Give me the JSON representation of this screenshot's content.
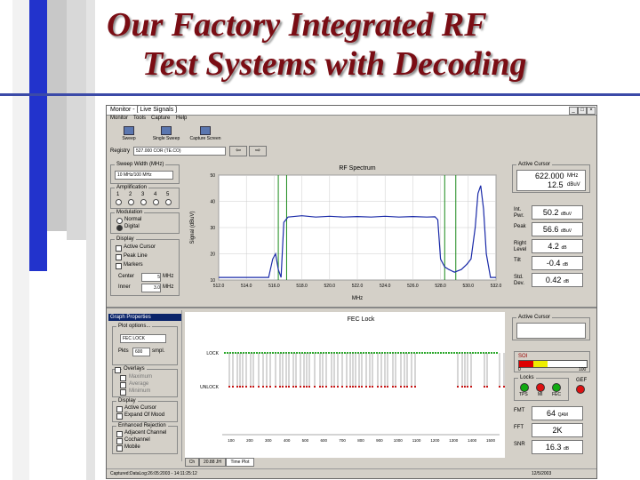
{
  "slide": {
    "title_line1": "Our Factory Integrated RF",
    "title_line2": "Test Systems with Decoding"
  },
  "window": {
    "title": "Monitor - [ Live Signals ]",
    "menu": [
      "Monitor",
      "Tools",
      "Capture",
      "Help"
    ],
    "toolbar": [
      "Sweep",
      "Single Sweep",
      "Capture Screen"
    ],
    "registry_label": "Registry",
    "registry_value": "527.000 COR (TE.CO)"
  },
  "rf": {
    "sweep_label": "Sweep Width (MHz)",
    "sweep_value": "10 MHz/100 MHz",
    "amp_label": "Amplification",
    "amp_steps": [
      "1",
      "2",
      "3",
      "4",
      "5"
    ],
    "mod_label": "Modulation",
    "mod_options": [
      "Normal",
      "Digital"
    ],
    "display_label": "Display",
    "display_options": [
      "Active Cursor",
      "Peak Line",
      "Markers"
    ],
    "center_label": "Center",
    "center_value": "5",
    "center_unit": "MHz",
    "span_label": "Inner",
    "span_value": "3.0",
    "span_unit": "MHz",
    "active_cursor_label": "Active Cursor",
    "cursor_freq": "622.000",
    "cursor_freq_unit": "MHz",
    "cursor_level": "12.5",
    "cursor_level_unit": "dBuV",
    "readouts": [
      {
        "label": "Int. Pwr.",
        "value": "50.2",
        "unit": "dBuV"
      },
      {
        "label": "Peak",
        "value": "56.6",
        "unit": "dBuV"
      },
      {
        "label": "Right Level",
        "value": "4.2",
        "unit": "dB"
      },
      {
        "label": "Tilt",
        "value": "-0.4",
        "unit": "dB"
      },
      {
        "label": "Std. Dev.",
        "value": "0.42",
        "unit": "dB"
      }
    ]
  },
  "fec": {
    "graph_props_label": "Graph Properties",
    "plot_label": "Plot options...",
    "plot_value": "FEC LOCK",
    "pkts_label": "Pkts",
    "pkts_value": "600",
    "pkts_unit": "smpl.",
    "overlays_label": "Overlays",
    "overlays": [
      "Maximum",
      "Average",
      "Minimum"
    ],
    "display_label": "Display",
    "display_options": [
      "Active Cursor",
      "Expand Of Mood"
    ],
    "rej_label": "Enhanced Rejection",
    "rej_options": [
      "Adjacent Channel",
      "Cochannel",
      "Mobile"
    ],
    "active_cursor_label": "Active Cursor",
    "soi_label": "SOI",
    "soi_min": "0",
    "soi_max": "100",
    "locks_label": "Locks",
    "leds": [
      "TPS",
      "MI",
      "FEC"
    ],
    "gef_label": "GEF",
    "readouts": [
      {
        "label": "FMT",
        "value": "64",
        "unit": "QAM"
      },
      {
        "label": "FFT",
        "value": "2K",
        "unit": ""
      },
      {
        "label": "SNR",
        "value": "16.3",
        "unit": "dB"
      }
    ],
    "tabs": [
      "Ch",
      "20.88 JH",
      "Time Plot"
    ],
    "status_left": "Captured:DataLog:26:05:2003 - 14:11:25:12",
    "status_right": "12/5/2003"
  },
  "chart_data": [
    {
      "type": "line",
      "title": "RF Spectrum",
      "xlabel": "MHz",
      "ylabel": "Signal (dBuV)",
      "xlim": [
        512.0,
        532.0
      ],
      "ylim": [
        10,
        50
      ],
      "x_ticks": [
        "512.0",
        "514.0",
        "516.0",
        "518.0",
        "520.0",
        "522.0",
        "524.0",
        "526.0",
        "528.0",
        "530.0",
        "532.0"
      ],
      "y_ticks": [
        "10",
        "20",
        "30",
        "40",
        "50"
      ],
      "series": [
        {
          "values": [
            [
              512.0,
              11
            ],
            [
              514.0,
              11
            ],
            [
              515.6,
              11
            ],
            [
              515.9,
              18
            ],
            [
              516.1,
              20
            ],
            [
              516.3,
              14
            ],
            [
              516.5,
              11
            ],
            [
              516.7,
              32
            ],
            [
              517.0,
              34
            ],
            [
              518.0,
              34.5
            ],
            [
              519.0,
              34
            ],
            [
              520.0,
              34.3
            ],
            [
              521.0,
              34
            ],
            [
              522.0,
              34.2
            ],
            [
              523.0,
              34
            ],
            [
              524.0,
              34.3
            ],
            [
              525.0,
              34
            ],
            [
              526.0,
              34.2
            ],
            [
              527.0,
              34
            ],
            [
              527.6,
              34.1
            ],
            [
              527.8,
              33
            ],
            [
              528.0,
              18
            ],
            [
              528.3,
              15
            ],
            [
              528.6,
              14
            ],
            [
              529.0,
              13
            ],
            [
              529.5,
              14
            ],
            [
              529.9,
              16
            ],
            [
              530.2,
              18
            ],
            [
              530.5,
              30
            ],
            [
              530.7,
              43
            ],
            [
              530.9,
              46
            ],
            [
              531.1,
              37
            ],
            [
              531.3,
              20
            ],
            [
              531.6,
              11
            ],
            [
              532.0,
              11
            ]
          ]
        }
      ],
      "markers_x": [
        516.3,
        516.9,
        528.3,
        529.1
      ]
    },
    {
      "type": "line",
      "title": "FEC Lock",
      "xlabel": "",
      "ylabel": "",
      "y_ticks": [
        "LOCK",
        "UNLOCK"
      ],
      "x_ticks": [
        "100",
        "200",
        "300",
        "400",
        "500",
        "600",
        "700",
        "800",
        "900",
        "1000",
        "1100",
        "1200",
        "1300",
        "1400",
        "1500"
      ],
      "series": [
        {
          "values": []
        }
      ]
    }
  ]
}
